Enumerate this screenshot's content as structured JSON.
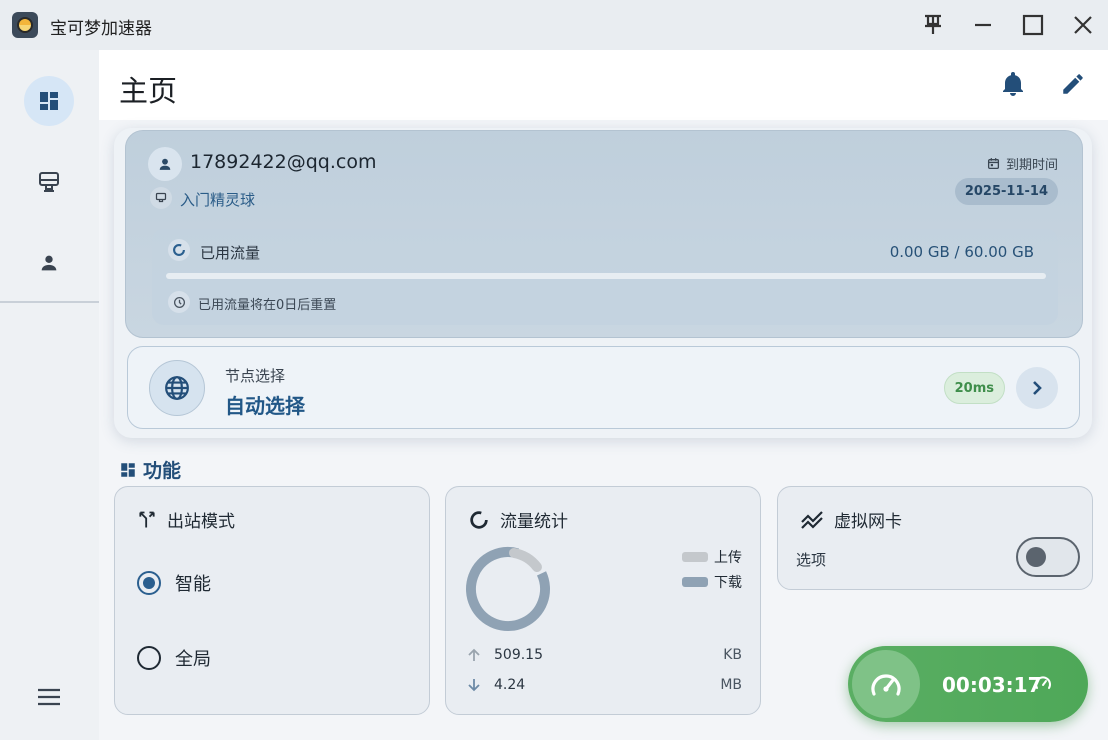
{
  "app": {
    "title": "宝可梦加速器"
  },
  "page": {
    "title": "主页"
  },
  "account": {
    "email": "17892422@qq.com",
    "plan": "入门精灵球",
    "expire_label": "到期时间",
    "expire_date": "2025-11-14",
    "traffic_label": "已用流量",
    "traffic_value": "0.00 GB / 60.00 GB",
    "traffic_used_fraction": 0.0,
    "reset_text": "已用流量将在0日后重置"
  },
  "node": {
    "label": "节点选择",
    "value": "自动选择",
    "latency": "20ms"
  },
  "features": {
    "title": "功能",
    "outbound": {
      "title": "出站模式",
      "options": [
        {
          "label": "智能",
          "selected": true
        },
        {
          "label": "全局",
          "selected": false
        }
      ]
    },
    "traffic_stats": {
      "title": "流量统计",
      "legend_upload": "上传",
      "legend_download": "下载",
      "upload_value": "509.15",
      "upload_unit": "KB",
      "download_value": "4.24",
      "download_unit": "MB"
    },
    "vnic": {
      "title": "虚拟网卡",
      "option_label": "选项",
      "enabled": false
    }
  },
  "connect": {
    "timer": "00:03:17"
  },
  "colors": {
    "accent": "#2b5f8f",
    "connected_green": "#4ea858",
    "upload_color": "#c4c8cc",
    "download_color": "#8fa2b4"
  }
}
